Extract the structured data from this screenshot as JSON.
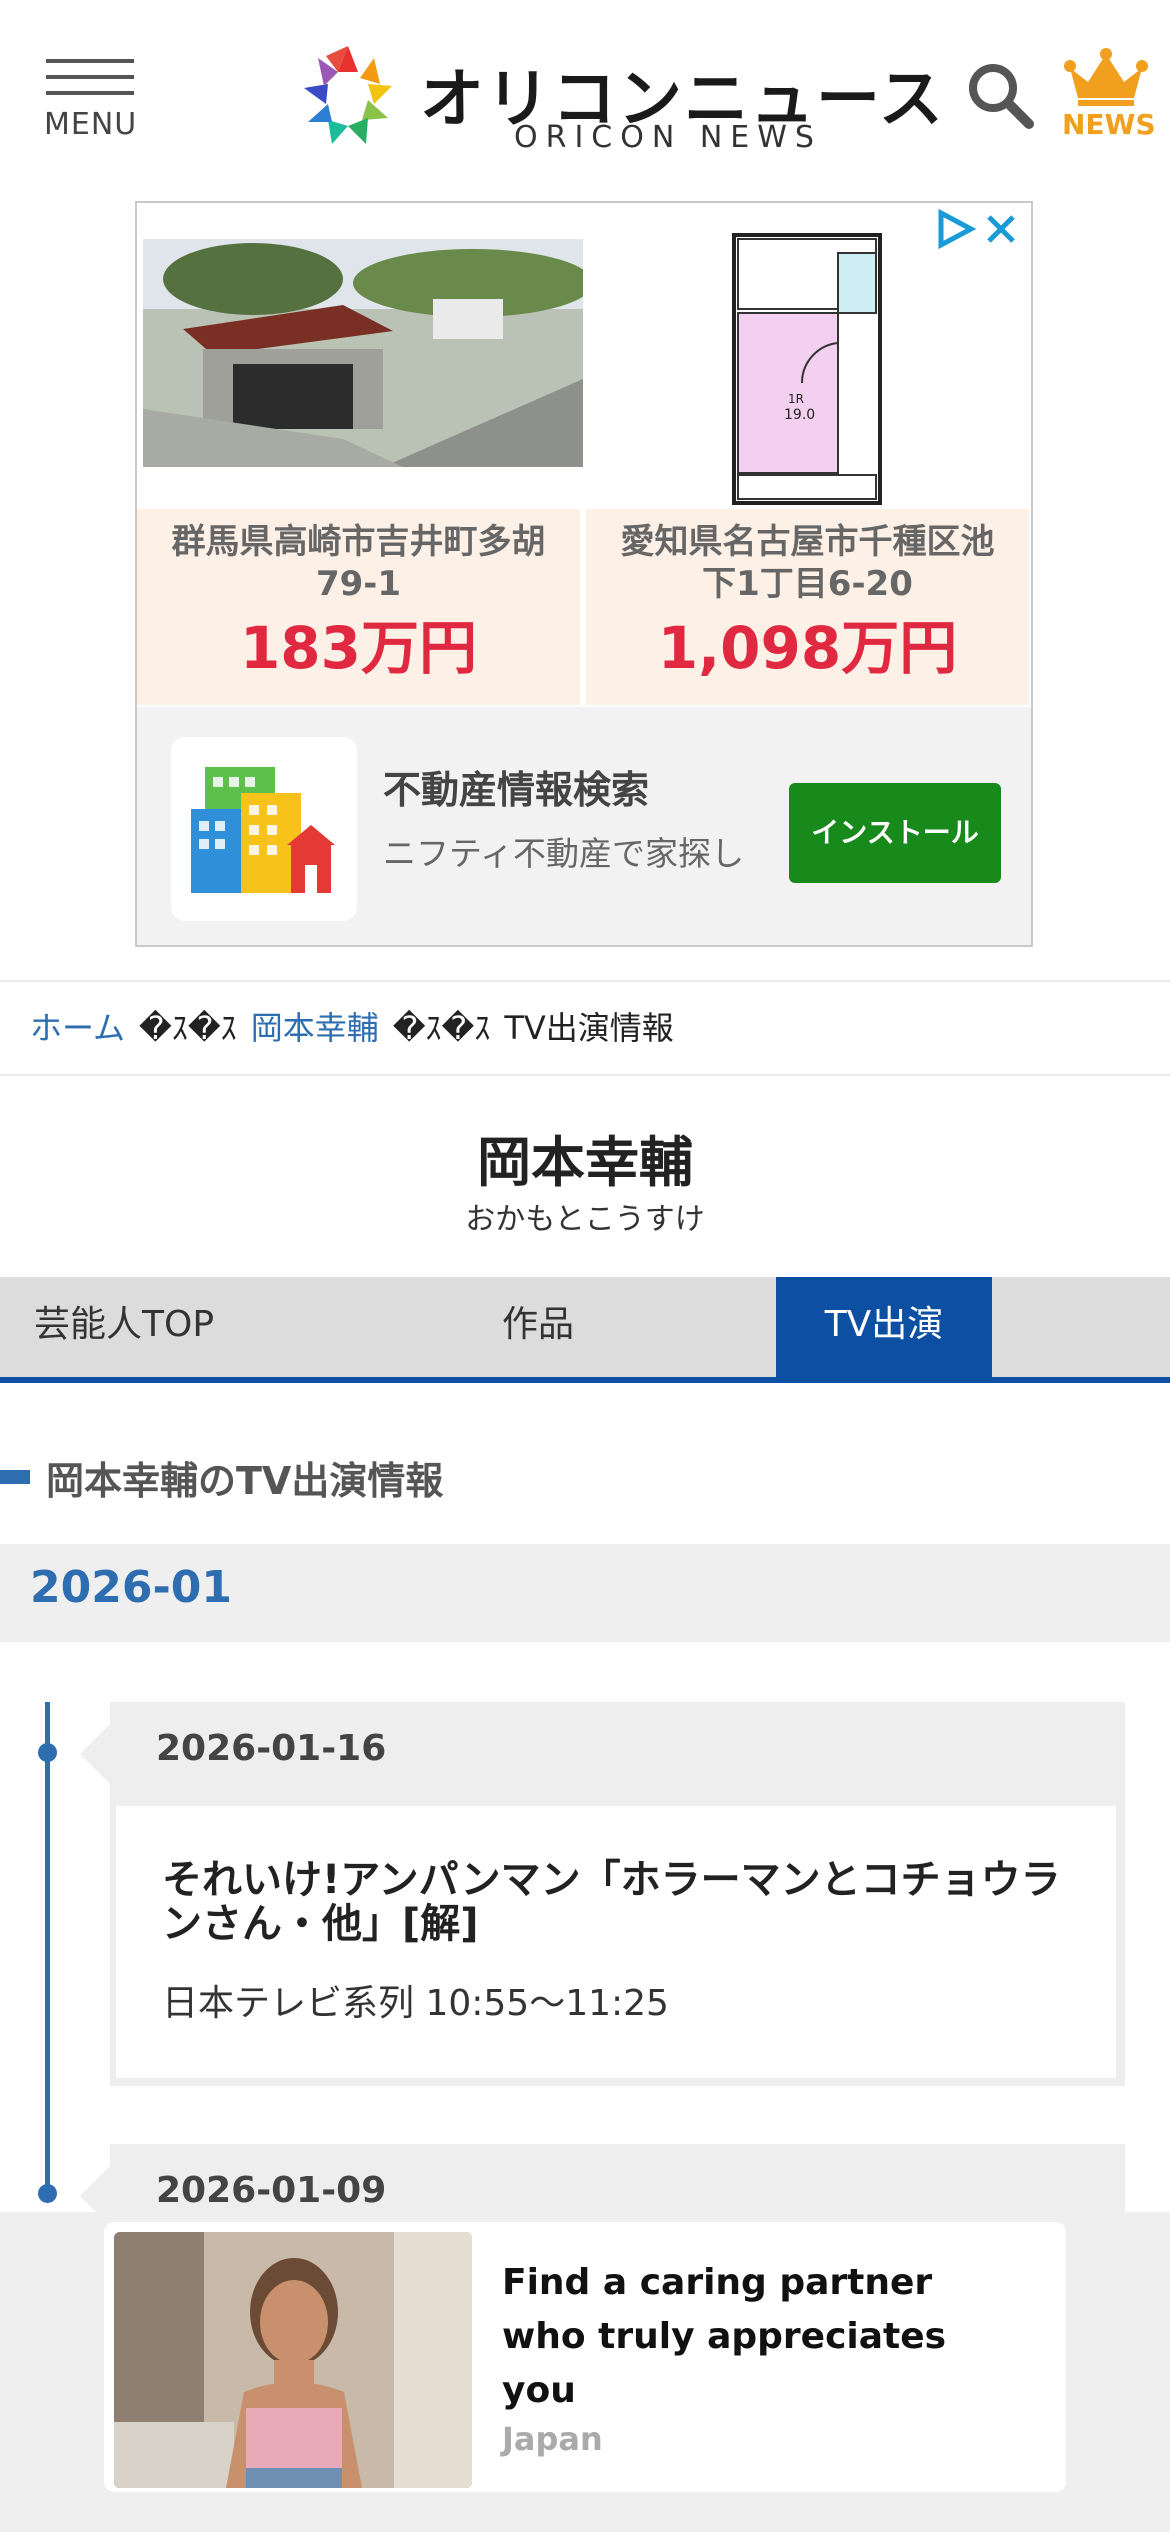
{
  "header": {
    "menu_label": "MENU",
    "logo_jp": "オリコンニュース",
    "logo_en": "ORICON NEWS",
    "news_label": "NEWS",
    "icons": [
      "menu-icon",
      "search-icon",
      "crown-icon"
    ]
  },
  "ad": {
    "listings": [
      {
        "address": "群馬県高崎市吉井町多胡\n79-1",
        "price": "183万円"
      },
      {
        "address": "愛知県名古屋市千種区池\n下1丁目6-20",
        "price": "1,098万円"
      }
    ],
    "floorplan_label": "1R\n19.0",
    "app_title": "不動産情報検索",
    "app_subtitle": "ニフティ不動産で家探し",
    "install_label": "インストール"
  },
  "breadcrumb": {
    "home": "ホーム",
    "separator": "�ｽ�ｽ",
    "person": "岡本幸輔",
    "current": "TV出演情報"
  },
  "person": {
    "name": "岡本幸輔",
    "kana": "おかもとこうすけ"
  },
  "tabs": [
    {
      "label": "芸能人TOP",
      "active": false
    },
    {
      "label": "作品",
      "active": false
    },
    {
      "label": "TV出演",
      "active": true
    }
  ],
  "section": {
    "title": "岡本幸輔のTV出演情報",
    "month": "2026-01"
  },
  "entries": [
    {
      "date": "2026-01-16",
      "title": "それいけ!アンパンマン「ホラーマンとコチョウランさん・他」[解]",
      "station": "日本テレビ系列 10:55～11:25"
    },
    {
      "date": "2026-01-09"
    }
  ],
  "bottom_ad": {
    "title": "Find a caring partner who truly appreciates you",
    "source": "Japan"
  },
  "colors": {
    "accent": "#2e6db0",
    "tab_active": "#0d4fa3",
    "price": "#e02840",
    "install": "#178a1b",
    "news": "#f0a01e"
  }
}
